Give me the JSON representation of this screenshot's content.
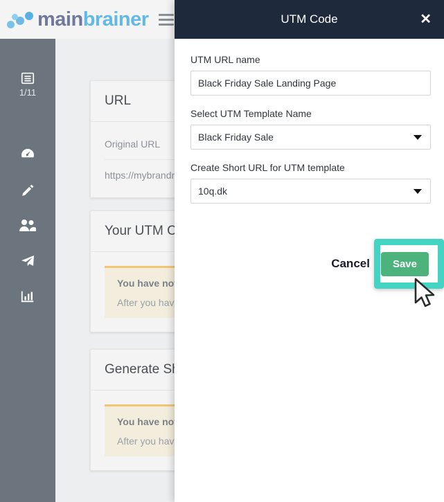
{
  "brand": {
    "name_part1": "main",
    "name_part2": "brainer",
    "menu_icon": "hamburger-icon"
  },
  "sidebar": {
    "items": [
      {
        "icon": "list-checklist-icon",
        "badge": "1/11"
      },
      {
        "icon": "dashboard-speedometer-icon",
        "badge": ""
      },
      {
        "icon": "pencil-edit-icon",
        "badge": ""
      },
      {
        "icon": "people-audience-icon",
        "badge": ""
      },
      {
        "icon": "paper-plane-send-icon",
        "badge": ""
      },
      {
        "icon": "bar-chart-statistics-icon",
        "badge": ""
      }
    ]
  },
  "background": {
    "cards": [
      {
        "title": "URL",
        "label": "Original URL",
        "value": "https://mybrandn"
      },
      {
        "title": "Your UTM Code",
        "alert_title": "You have not U",
        "alert_text": "After you have"
      },
      {
        "title": "Generate Short",
        "alert_title": "You have not G",
        "alert_text": "After you have"
      }
    ]
  },
  "modal": {
    "title": "UTM Code",
    "close_label": "✕",
    "fields": {
      "url_name": {
        "label": "UTM URL name",
        "value": "Black Friday Sale Landing Page",
        "placeholder": "UTM URL name"
      },
      "template_name": {
        "label": "Select UTM Template Name",
        "value": "Black Friday Sale"
      },
      "short_url": {
        "label": "Create Short URL for UTM template",
        "value": "10q.dk"
      }
    },
    "buttons": {
      "cancel": "Cancel",
      "save": "Save"
    }
  },
  "annotation": {
    "highlight_color": "#44d4c4",
    "cursor": "mouse-pointer-arrow"
  },
  "colors": {
    "sidebar": "#6c757d",
    "modal_header": "#1e293b",
    "save_button": "#4cb37c",
    "alert_border": "#f0c674",
    "alert_bg": "#f3eddd",
    "brand_blue": "#62b8e6",
    "brand_slate": "#70799c"
  }
}
